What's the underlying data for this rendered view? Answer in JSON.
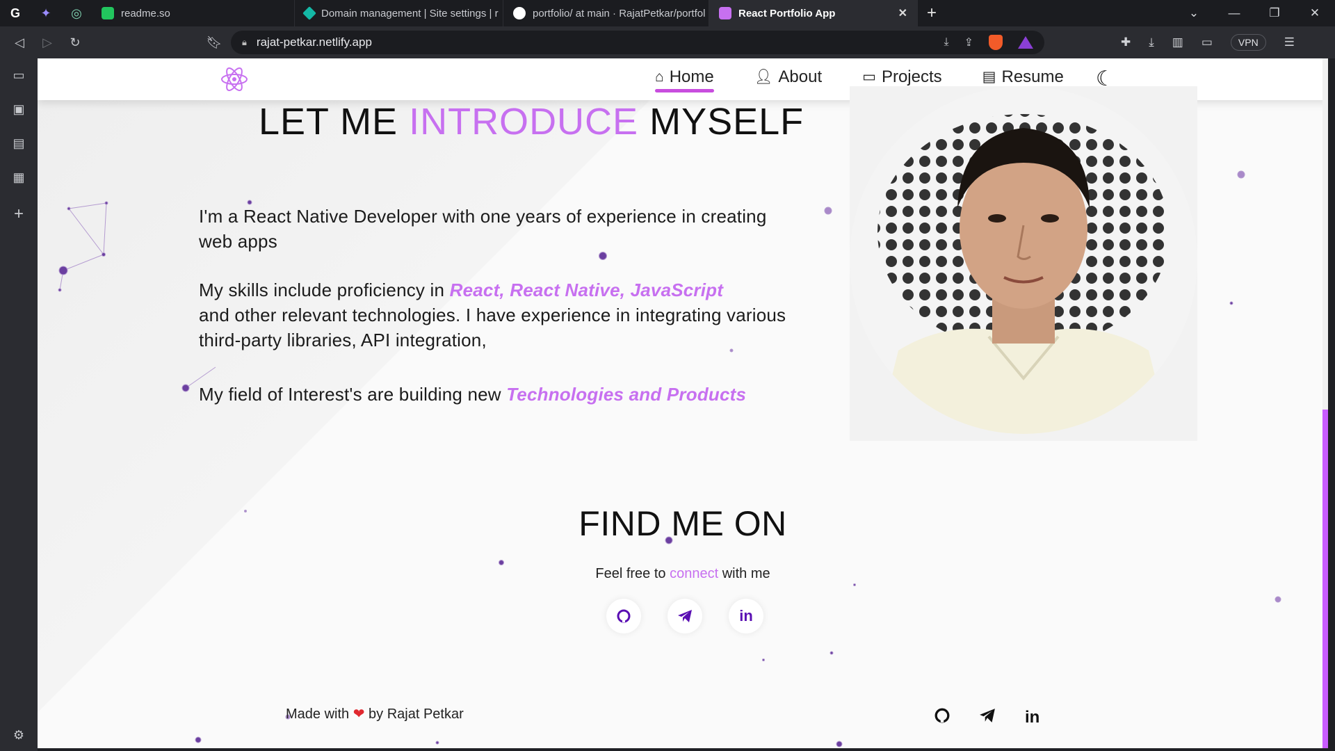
{
  "browser": {
    "tabs": [
      {
        "title": "readme.so",
        "fav_color": "#22c55e"
      },
      {
        "title": "Domain management | Site settings | r",
        "fav_color": "#14b8a6"
      },
      {
        "title": "portfolio/ at main · RajatPetkar/portfol",
        "fav_color": "#ffffff"
      },
      {
        "title": "React Portfolio App",
        "fav_color": "#c770f0"
      }
    ],
    "url": "rajat-petkar.netlify.app",
    "vpn_label": "VPN"
  },
  "nav": {
    "items": [
      {
        "label": "Home",
        "icon": "home-icon"
      },
      {
        "label": "About",
        "icon": "user-icon"
      },
      {
        "label": "Projects",
        "icon": "projects-icon"
      },
      {
        "label": "Resume",
        "icon": "document-icon"
      }
    ]
  },
  "intro": {
    "title_part1": "LET ME ",
    "title_highlight": "INTRODUCE",
    "title_part3": " MYSELF",
    "p1": "I'm a React Native Developer with one years of experience in creating web apps",
    "p2_prefix": "My skills include proficiency in ",
    "p2_highlight": "React, React Native, JavaScript",
    "p2_rest": "and other relevant technologies. I have experience in integrating various third-party libraries, API integration,",
    "p3_prefix": "My field of Interest's are building new ",
    "p3_highlight": "Technologies and Products"
  },
  "find": {
    "title": "FIND ME ON",
    "sub_prefix": "Feel free to ",
    "sub_highlight": "connect",
    "sub_suffix": " with me"
  },
  "footer": {
    "made_prefix": "Made with ",
    "made_suffix": " by Rajat Petkar"
  },
  "colors": {
    "accent": "#c770f0",
    "icon_purple": "#5a0fb3"
  }
}
